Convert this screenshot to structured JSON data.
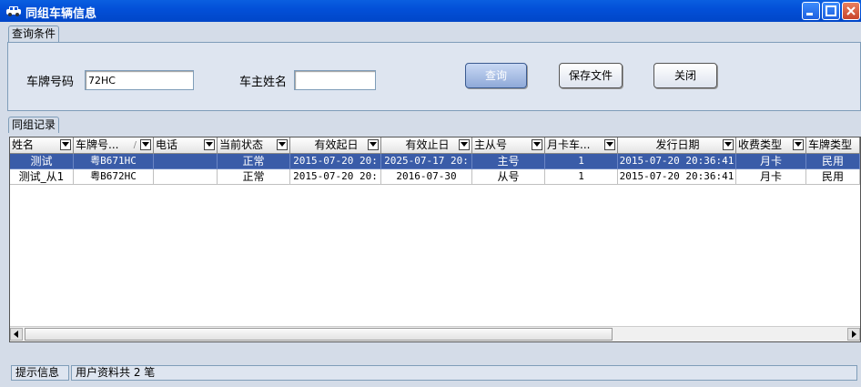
{
  "window": {
    "title": "同组车辆信息"
  },
  "query_tab": {
    "label": "查询条件"
  },
  "query": {
    "plate_label": "车牌号码",
    "plate_value": "72HC",
    "owner_label": "车主姓名",
    "owner_value": "",
    "query_button": "查询",
    "save_button": "保存文件",
    "close_button": "关闭"
  },
  "records_tab": {
    "label": "同组记录"
  },
  "grid": {
    "columns": [
      "姓名",
      "车牌号...",
      "电话",
      "当前状态",
      "有效起日",
      "有效止日",
      "主从号",
      "月卡车...",
      "发行日期",
      "收费类型",
      "车牌类型"
    ],
    "rows": [
      [
        "测试",
        "粤B671HC",
        "",
        "正常",
        "2015-07-20 20:",
        "2025-07-17 20:",
        "主号",
        "1",
        "2015-07-20 20:36:41",
        "月卡",
        "民用"
      ],
      [
        "测试_从1",
        "粤B672HC",
        "",
        "正常",
        "2015-07-20 20:",
        "2016-07-30",
        "从号",
        "1",
        "2015-07-20 20:36:41",
        "月卡",
        "民用"
      ]
    ],
    "sort_indicator": "/"
  },
  "status": {
    "label": "提示信息",
    "message": "用户资料共 2 笔"
  },
  "colors": {
    "titlebar": "#0350D8",
    "selection": "#3A5CA8",
    "panel": "#DEE5F0"
  }
}
